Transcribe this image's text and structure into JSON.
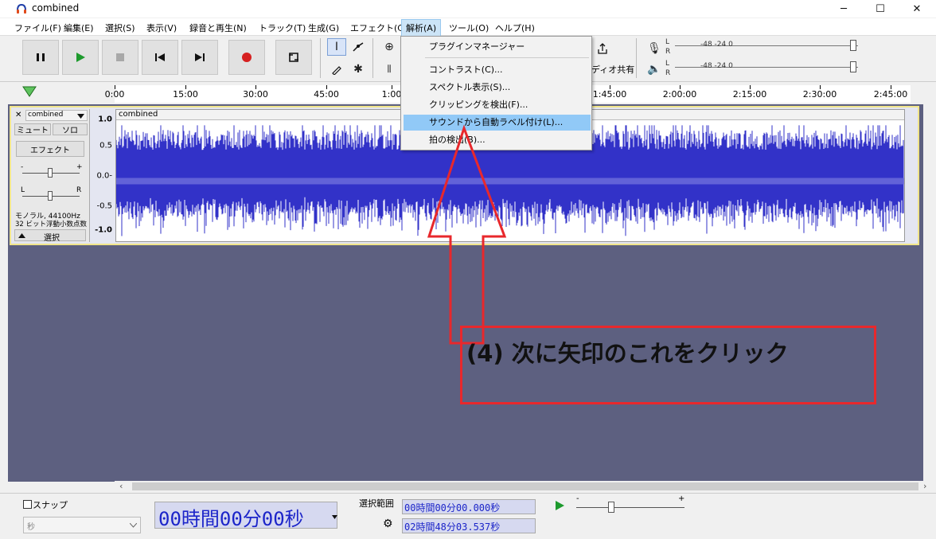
{
  "window": {
    "title": "combined",
    "min": "─",
    "max": "☐",
    "close": "✕"
  },
  "menus": [
    "ファイル(F)",
    "編集(E)",
    "選択(S)",
    "表示(V)",
    "録音と再生(N)",
    "トラック(T)",
    "生成(G)",
    "エフェクト(C)",
    "解析(A)",
    "ツール(O)",
    "ヘルプ(H)"
  ],
  "toolbar": {
    "share_label": "ディオ共有",
    "meter": {
      "rec_ticks": "-48          -24          0",
      "play_ticks": "-48          -24          0",
      "L": "L",
      "R": "R"
    }
  },
  "ruler": {
    "ticks": [
      "0:00",
      "15:00",
      "30:00",
      "45:00",
      "1:00",
      "1:45:00",
      "2:00:00",
      "2:15:00",
      "2:30:00",
      "2:45:00"
    ]
  },
  "track": {
    "name": "combined",
    "mute": "ミュート",
    "solo": "ソロ",
    "effect": "エフェクト",
    "gain_minus": "-",
    "gain_plus": "+",
    "pan_l": "L",
    "pan_r": "R",
    "info1": "モノラル, 44100Hz",
    "info2": "32 ビット浮動小数点数",
    "select": "選択",
    "clip_name": "combined",
    "scale": [
      "1.0",
      "0.5",
      "0.0-",
      "-0.5",
      "-1.0"
    ]
  },
  "dropdown": {
    "items": [
      "プラグインマネージャー",
      "コントラスト(C)...",
      "スペクトル表示(S)...",
      "クリッピングを検出(F)...",
      "サウンドから自動ラベル付け(L)...",
      "拍の検出(B)..."
    ],
    "highlighted": "サウンドから自動ラベル付け(L)..."
  },
  "annotation": {
    "text": "(4) 次に矢印のこれをクリック",
    "color": "#e8282c"
  },
  "statusbar": {
    "snap_label": "スナップ",
    "snap_unit": "秒",
    "big_time": "00時間00分00秒",
    "selection_label": "選択範囲",
    "sel_start": "00時間00分00.000秒",
    "sel_end": "02時間48分03.537秒",
    "slider_minus": "-",
    "slider_plus": "+"
  },
  "colors": {
    "waveform": "#3232c8",
    "track_bg": "#5d6080",
    "highlight": "#91c9f7"
  }
}
